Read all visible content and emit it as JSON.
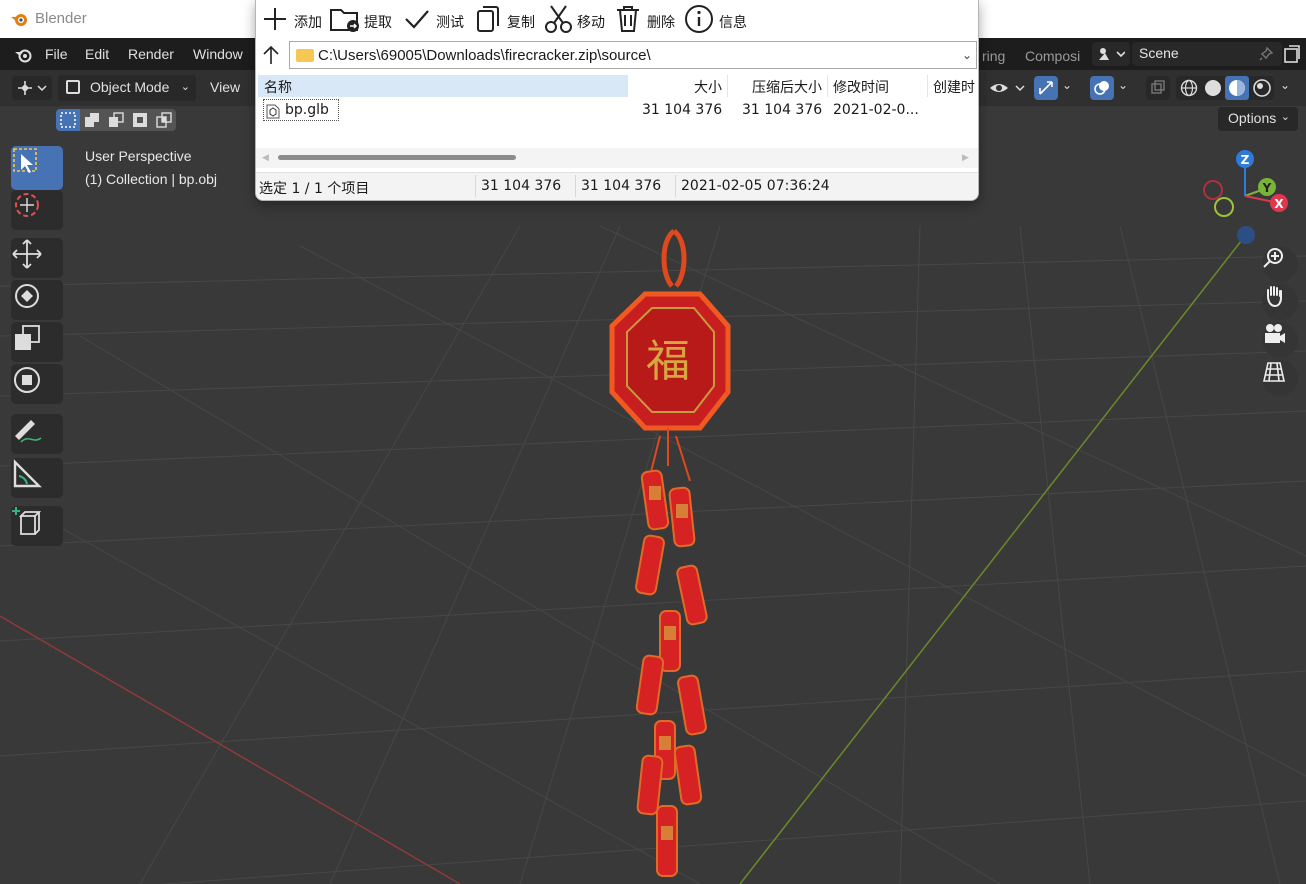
{
  "blender": {
    "title": "Blender",
    "menu": [
      "File",
      "Edit",
      "Render",
      "Window"
    ],
    "workspace_tabs": [
      "ring",
      "Composi"
    ],
    "scene": "Scene",
    "mode": "Object Mode",
    "view_menu": "View",
    "options": "Options",
    "viewport": {
      "perspective": "User Perspective",
      "collection": "(1) Collection | bp.obj"
    },
    "gizmo": {
      "z": "Z",
      "y": "Y",
      "x": "X"
    },
    "accent_color": "#4772b3",
    "tools": [
      "select-box",
      "cursor",
      "move",
      "rotate",
      "scale",
      "transform",
      "annotate",
      "measure",
      "add-cube"
    ]
  },
  "zip": {
    "toolbar": [
      {
        "icon": "plus-icon",
        "label": "添加"
      },
      {
        "icon": "extract-icon",
        "label": "提取"
      },
      {
        "icon": "check-icon",
        "label": "测试"
      },
      {
        "icon": "copy-icon",
        "label": "复制"
      },
      {
        "icon": "scissors-icon",
        "label": "移动"
      },
      {
        "icon": "trash-icon",
        "label": "删除"
      },
      {
        "icon": "info-icon",
        "label": "信息"
      }
    ],
    "path": "C:\\Users\\69005\\Downloads\\firecracker.zip\\source\\",
    "columns": [
      "名称",
      "大小",
      "压缩后大小",
      "修改时间",
      "创建时"
    ],
    "rows": [
      {
        "name": "bp.glb",
        "size": "31 104 376",
        "packed": "31 104 376",
        "modified": "2021-02-0..."
      }
    ],
    "status": {
      "selection": "选定 1 / 1 个项目",
      "size": "31 104 376",
      "packed": "31 104 376",
      "modified": "2021-02-05 07:36:24"
    }
  }
}
